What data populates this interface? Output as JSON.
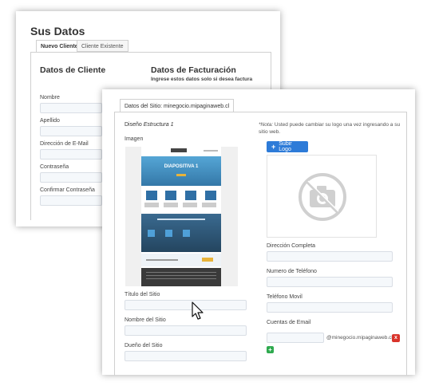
{
  "back": {
    "title": "Sus Datos",
    "tabs": [
      "Nuevo Cliente",
      "Cliente Existente"
    ],
    "client_heading": "Datos de Cliente",
    "billing_heading": "Datos de Facturación",
    "billing_note": "Ingrese estos datos solo si desea factura",
    "fields": [
      "Nombre",
      "Apellido",
      "Dirección de E-Mail",
      "Contraseña",
      "Confirmar Contraseña"
    ]
  },
  "front": {
    "tab": "Datos del Sitio: minegocio.mipaginaweb.cl",
    "design_label": "Diseño",
    "design_name": "Estructura 1",
    "image_label": "Imagen",
    "note_prefix": "*Nota:",
    "note_text": " Usted puede cambiar su logo una vez ingresando a su sitio web.",
    "upload_button": "Subir Logo",
    "left_fields": [
      "Título del Sitio",
      "Nombre del Sitio",
      "Dueño del Sitio"
    ],
    "right_fields": [
      "Dirección Completa",
      "Numero de Teléfono",
      "Teléfono Movil"
    ],
    "email_label": "Cuentas de Email",
    "email_domain": "@minegocio.mipaginaweb.cl",
    "remove_label": "x",
    "add_label": "+"
  },
  "preview": {
    "slide_title": "DIAPOSITIVA 1",
    "colors": {
      "hero": "#3f8fc4",
      "band": "#2a4f6e",
      "footer": "#3a3a3a",
      "accent": "#e8b33a"
    }
  },
  "icons": {
    "upload": "plus-icon",
    "logo_placeholder": "no-camera-icon",
    "cursor": "mouse-pointer-icon"
  }
}
